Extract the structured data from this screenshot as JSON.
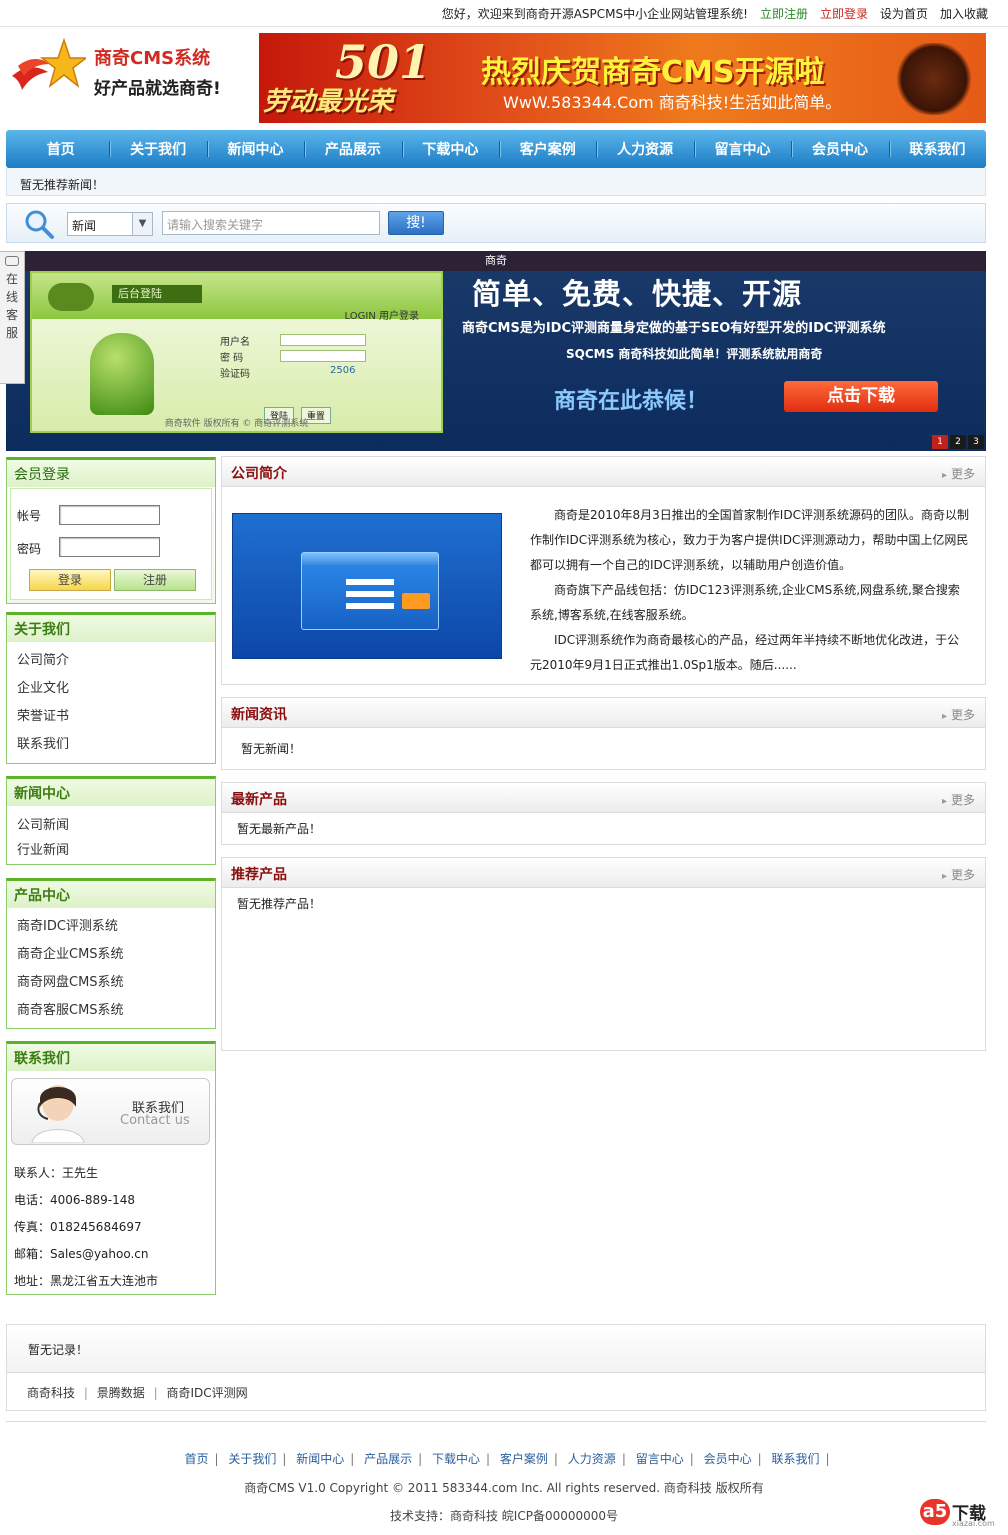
{
  "topbar": {
    "welcome": "您好，欢迎来到商奇开源ASPCMS中小企业网站管理系统!",
    "register": "立即注册",
    "login": "立即登录",
    "set_home": "设为首页",
    "favorite": "加入收藏"
  },
  "logo": {
    "line1": "商奇CMS系统",
    "line2": "好产品就选商奇!"
  },
  "banner": {
    "number": "501",
    "slogan": "劳动最光荣",
    "title": "热烈庆贺商奇CMS开源啦",
    "subtitle": "WwW.583344.Com 商奇科技!生活如此简单。"
  },
  "nav": {
    "items": [
      "首页",
      "关于我们",
      "新闻中心",
      "产品展示",
      "下载中心",
      "客户案例",
      "人力资源",
      "留言中心",
      "会员中心",
      "联系我们"
    ]
  },
  "news_ticker": "暂无推荐新闻！",
  "search": {
    "category": "新闻",
    "placeholder": "请输入搜索关键字",
    "button": "搜!"
  },
  "slider": {
    "caption": "商奇",
    "panel_title": "后台登陆",
    "panel_login": "LOGIN 用户登录",
    "panel_user": "用户名",
    "panel_pass": "密  码",
    "panel_code_label": "验证码",
    "panel_code": "2506",
    "panel_btn_login": "登陆",
    "panel_btn_reset": "重置",
    "panel_footer": "商奇软件  版权所有 © 商奇评测系统",
    "headline": "简单、免费、快捷、开源",
    "line2": "商奇CMS是为IDC评测商量身定做的基于SEO有好型开发的IDC评测系统",
    "line3": "SQCMS 商奇科技如此简单！评测系统就用商奇",
    "line4": "商奇在此恭候！",
    "download": "点击下载",
    "pages": [
      "1",
      "2",
      "3"
    ]
  },
  "kefu": "在线客服",
  "member_login": {
    "title": "会员登录",
    "account_label": "帐号",
    "password_label": "密码",
    "login_button": "登录",
    "register_button": "注册"
  },
  "about_menu": {
    "title": "关于我们",
    "items": [
      "公司简介",
      "企业文化",
      "荣誉证书",
      "联系我们"
    ]
  },
  "news_menu": {
    "title": "新闻中心",
    "items": [
      "公司新闻",
      "行业新闻"
    ]
  },
  "product_menu": {
    "title": "产品中心",
    "items": [
      "商奇IDC评测系统",
      "商奇企业CMS系统",
      "商奇网盘CMS系统",
      "商奇客服CMS系统"
    ]
  },
  "contact": {
    "title": "联系我们",
    "card_cn": "联系我们",
    "card_en": "Contact us",
    "person": "联系人：王先生",
    "phone": "电话：4006-889-148",
    "fax": "传真：018245684697",
    "email": "邮箱：Sales@yahoo.cn",
    "address": "地址：黑龙江省五大连池市"
  },
  "company_intro": {
    "title": "公司简介",
    "more": "更多",
    "p1": "商奇是2010年8月3日推出的全国首家制作IDC评测系统源码的团队。商奇以制作制作IDC评测系统为核心，致力于为客户提供IDC评测源动力，帮助中国上亿网民都可以拥有一个自己的IDC评测系统，以辅助用户创造价值。",
    "p2": "商奇旗下产品线包括：仿IDC123评测系统,企业CMS系统,网盘系统,聚合搜索系统,博客系统,在线客服系统。",
    "p3": "IDC评测系统作为商奇最核心的产品，经过两年半持续不断地优化改进，于公元2010年9月1日正式推出1.0Sp1版本。随后......"
  },
  "news_section": {
    "title": "新闻资讯",
    "more": "更多",
    "empty": "暂无新闻！"
  },
  "latest_products": {
    "title": "最新产品",
    "more": "更多",
    "empty": "暂无最新产品！"
  },
  "recommended_products": {
    "title": "推荐产品",
    "more": "更多",
    "empty": "暂无推荐产品！"
  },
  "links": {
    "empty": "暂无记录！",
    "items": [
      "商奇科技",
      "景腾数据",
      "商奇IDC评测网"
    ]
  },
  "footer": {
    "nav": [
      "首页",
      "关于我们",
      "新闻中心",
      "产品展示",
      "下载中心",
      "客户案例",
      "人力资源",
      "留言中心",
      "会员中心",
      "联系我们"
    ],
    "copyright": "商奇CMS V1.0 Copyright © 2011 583344.com Inc. All rights reserved. 商奇科技  版权所有",
    "support": "技术支持：商奇科技 皖ICP备00000000号"
  },
  "watermark": {
    "mark": "a5",
    "text": "下载",
    "site": "xiazai.com"
  }
}
